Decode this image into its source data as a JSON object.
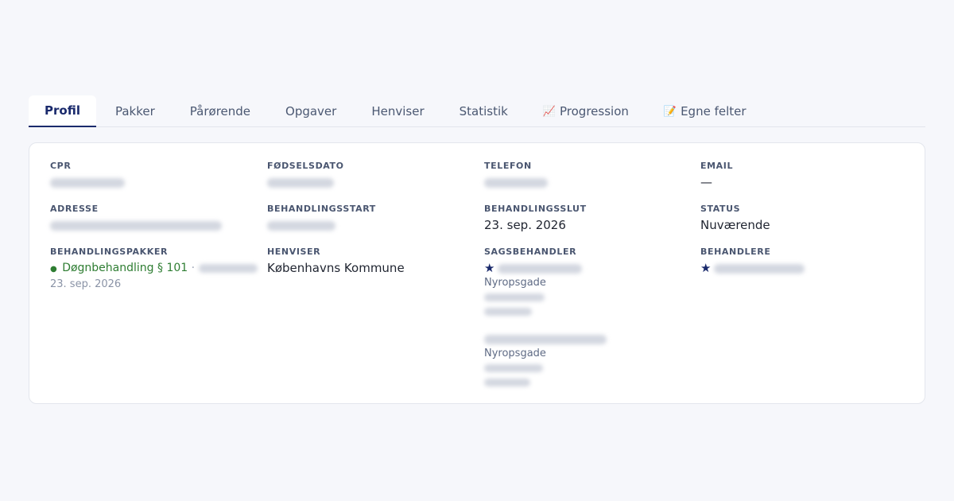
{
  "tabs": [
    {
      "label": "Profil",
      "active": true
    },
    {
      "label": "Pakker"
    },
    {
      "label": "Pårørende"
    },
    {
      "label": "Opgaver"
    },
    {
      "label": "Henviser"
    },
    {
      "label": "Statistik"
    },
    {
      "label": "Progression",
      "icon": "📈",
      "icon_name": "chart-icon"
    },
    {
      "label": "Egne felter",
      "icon": "📝",
      "icon_name": "memo-icon"
    }
  ],
  "profile": {
    "cpr": {
      "label": "CPR"
    },
    "fodselsdato": {
      "label": "Fødselsdato"
    },
    "telefon": {
      "label": "Telefon"
    },
    "email": {
      "label": "Email",
      "value": "—"
    },
    "adresse": {
      "label": "Adresse"
    },
    "behandlingsstart": {
      "label": "Behandlingsstart"
    },
    "behandlingsslut": {
      "label": "Behandlingsslut",
      "value": "23. sep. 2026"
    },
    "status": {
      "label": "Status",
      "value": "Nuværende"
    },
    "behandlingspakker": {
      "label": "Behandlingspakker",
      "package_name": "Døgnbehandling § 101",
      "separator": "·",
      "end_date": "23. sep. 2026"
    },
    "henviser": {
      "label": "Henviser",
      "value": "Københavns Kommune"
    },
    "sagsbehandler": {
      "label": "Sagsbehandler",
      "entries": [
        {
          "street": "Nyropsgade"
        },
        {
          "street": "Nyropsgade"
        }
      ]
    },
    "behandlere": {
      "label": "Behandlere"
    }
  },
  "colors": {
    "accent": "#1a2a6c",
    "package_green": "#2e7d32",
    "label_gray": "#4a5670"
  }
}
